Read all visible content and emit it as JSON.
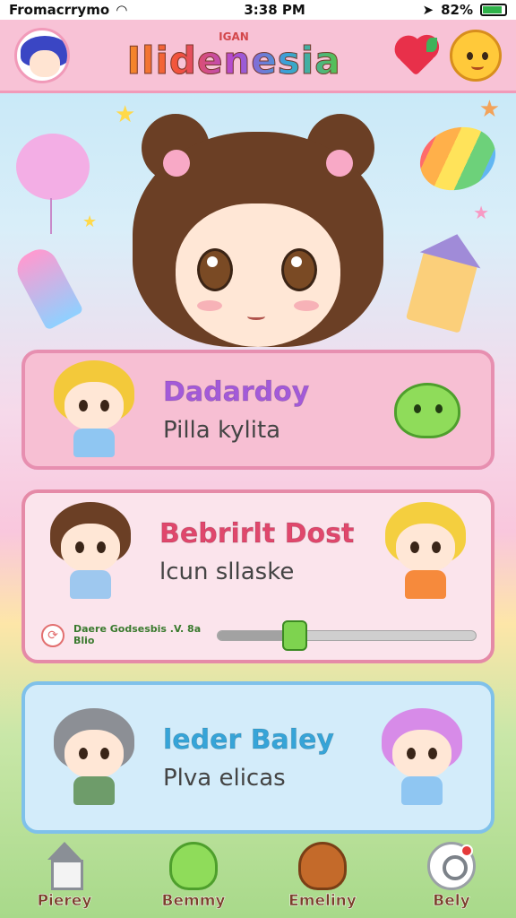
{
  "status_bar": {
    "carrier": "Fromacrrymo",
    "time": "3:38 PM",
    "battery": "82%"
  },
  "header": {
    "logo_small": "IGAN",
    "logo": "Ilidenesia"
  },
  "cards": [
    {
      "title": "Dadardoy",
      "subtitle": "Pilla kylita",
      "title_color": "#a35ad9"
    },
    {
      "title": "Bebrirlt Dost",
      "subtitle": "lcun sllaske",
      "title_color": "#e0476c",
      "progress": {
        "label_line1": "Daere Godsesbis .V. 8a",
        "label_line2": "Blio",
        "fraction": 0.3
      }
    },
    {
      "title": "leder Baley",
      "subtitle": "Plva elicas",
      "title_color": "#36a4d8"
    }
  ],
  "nav": [
    {
      "label": "Pierey",
      "icon": "house-icon"
    },
    {
      "label": "Bemmy",
      "icon": "slime-icon"
    },
    {
      "label": "Emeliny",
      "icon": "chocolate-icon"
    },
    {
      "label": "Bely",
      "icon": "search-icon"
    }
  ]
}
